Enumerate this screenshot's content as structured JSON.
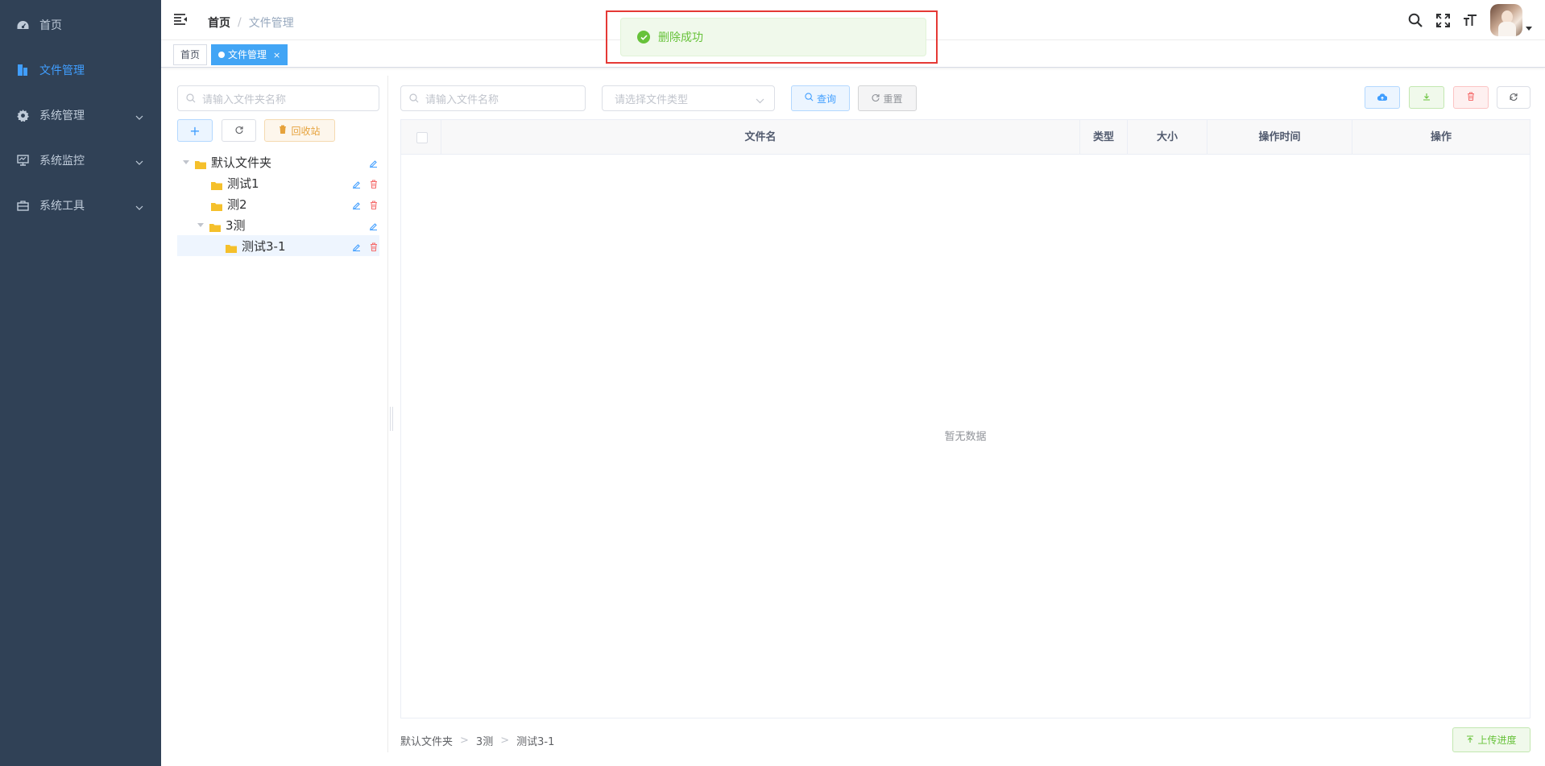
{
  "sidebar": {
    "items": [
      {
        "label": "首页",
        "icon": "dashboard-icon"
      },
      {
        "label": "文件管理",
        "icon": "file-icon",
        "active": true
      },
      {
        "label": "系统管理",
        "icon": "gear-icon"
      },
      {
        "label": "系统监控",
        "icon": "monitor-icon"
      },
      {
        "label": "系统工具",
        "icon": "toolbox-icon"
      }
    ]
  },
  "navbar": {
    "breadcrumb": [
      "首页",
      "文件管理"
    ],
    "separator": "/"
  },
  "tags": [
    {
      "label": "首页"
    },
    {
      "label": "文件管理",
      "active": true,
      "close": "×"
    }
  ],
  "toast": {
    "message": "删除成功",
    "type": "success"
  },
  "left": {
    "search_placeholder": "请输入文件夹名称",
    "add_label": "+",
    "recycle_label": "回收站"
  },
  "tree": [
    {
      "label": "默认文件夹",
      "level": 0,
      "expanded": true
    },
    {
      "label": "测试1",
      "level": 1
    },
    {
      "label": "测2",
      "level": 1
    },
    {
      "label": "3测",
      "level": 1,
      "expanded": true
    },
    {
      "label": "测试3-1",
      "level": 2,
      "selected": true
    }
  ],
  "right": {
    "file_search_placeholder": "请输入文件名称",
    "type_select_placeholder": "请选择文件类型",
    "query_label": "查询",
    "reset_label": "重置"
  },
  "table": {
    "columns": [
      "文件名",
      "类型",
      "大小",
      "操作时间",
      "操作"
    ],
    "empty_text": "暂无数据"
  },
  "path": [
    "默认文件夹",
    "3测",
    "测试3-1"
  ],
  "path_separator": ">",
  "upload_progress_label": "上传进度",
  "colors": {
    "sidebar_bg": "#304156",
    "primary": "#409eff",
    "success": "#67c23a",
    "danger": "#f56c6c",
    "warning": "#e6a23c"
  }
}
